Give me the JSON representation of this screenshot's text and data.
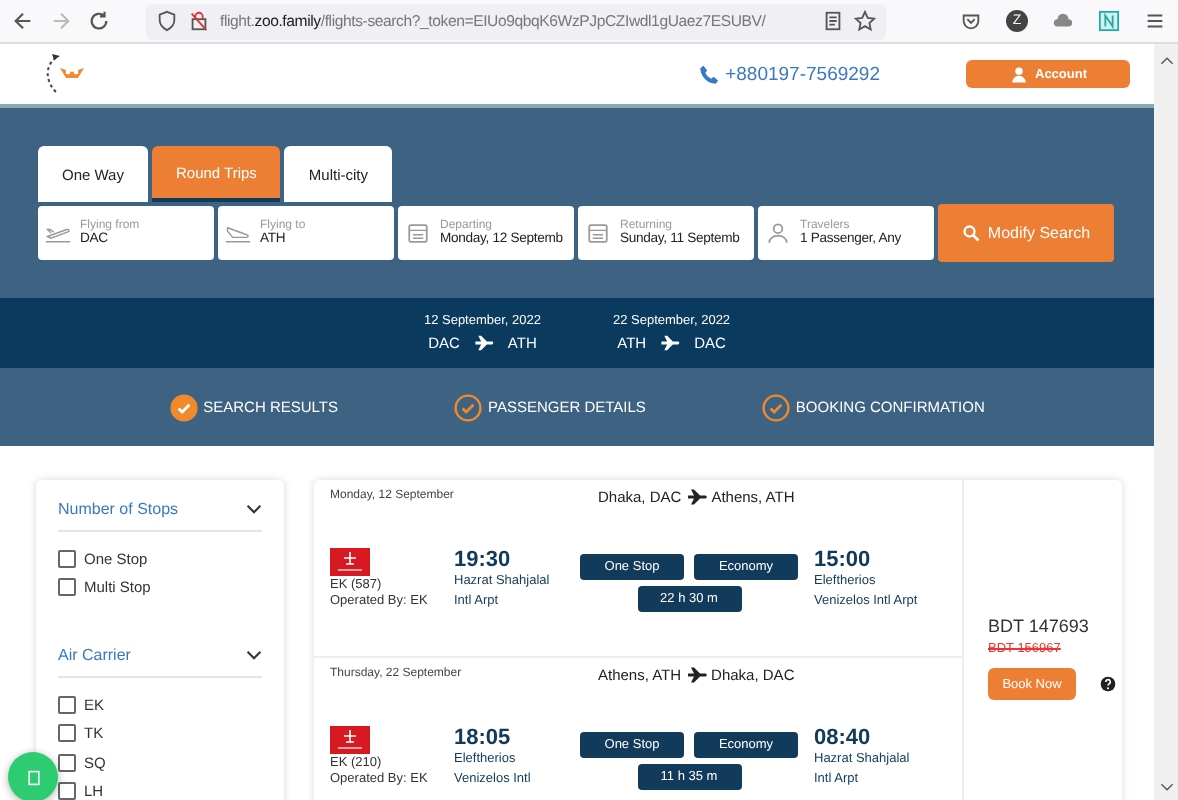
{
  "browser": {
    "url": "flight.**zoo.family**/flights-search?_token=EIUo9qbqK6WzPJpCZIwdl1gUaez7ESUBV/",
    "profile": "Z"
  },
  "header": {
    "phone": "+880197-7569292",
    "account_button": "Account"
  },
  "search": {
    "tabs": [
      {
        "label": "One Way",
        "selected": false
      },
      {
        "label": "Round Trips",
        "selected": true
      },
      {
        "label": "Multi-city",
        "selected": false
      }
    ],
    "fields": [
      {
        "kind": "plane-up",
        "label": "Flying from",
        "value": "DAC"
      },
      {
        "kind": "plane-down",
        "label": "Flying to",
        "value": "ATH"
      },
      {
        "kind": "calendar",
        "label": "Departing",
        "value": "Monday, 12 Septemb"
      },
      {
        "kind": "calendar",
        "label": "Returning",
        "value": "Sunday, 11 Septemb"
      },
      {
        "kind": "person",
        "label": "Travelers",
        "value": "1 Passenger, Any"
      }
    ],
    "button": "Modify Search"
  },
  "legs": [
    {
      "date": "12 September, 2022",
      "from": "DAC",
      "to": "ATH"
    },
    {
      "date": "22 September, 2022",
      "from": "ATH",
      "to": "DAC"
    }
  ],
  "steps": [
    {
      "label": "SEARCH RESULTS",
      "completed": true
    },
    {
      "label": "PASSENGER DETAILS",
      "completed": false
    },
    {
      "label": "BOOKING CONFIRMATION",
      "completed": false
    }
  ],
  "filters": [
    {
      "title": "Number of Stops",
      "options": [
        {
          "label": "One Stop",
          "checked": false
        },
        {
          "label": "Multi Stop",
          "checked": false
        }
      ]
    },
    {
      "title": "Air Carrier",
      "options": [
        {
          "label": "EK",
          "checked": false
        },
        {
          "label": "TK",
          "checked": false
        },
        {
          "label": "SQ",
          "checked": false
        },
        {
          "label": "LH",
          "checked": false
        }
      ]
    }
  ],
  "result": {
    "flights": [
      {
        "date": "Monday, 12 September",
        "route_from": "Dhaka, DAC",
        "route_to": "Athens, ATH",
        "flight_no": "EK (587)",
        "operated_by": "Operated By: EK",
        "dep_time": "19:30",
        "dep_airport": "Hazrat Shahjalal Intl Arpt",
        "stops": "One Stop",
        "cabin": "Economy",
        "duration": "22 h 30 m",
        "arr_time": "15:00",
        "arr_airport": "Eleftherios Venizelos Intl Arpt"
      },
      {
        "date": "Thursday, 22 September",
        "route_from": "Athens, ATH",
        "route_to": "Dhaka, DAC",
        "flight_no": "EK (210)",
        "operated_by": "Operated By: EK",
        "dep_time": "18:05",
        "dep_airport": "Eleftherios Venizelos Intl",
        "stops": "One Stop",
        "cabin": "Economy",
        "duration": "11 h 35 m",
        "arr_time": "08:40",
        "arr_airport": "Hazrat Shahjalal Intl Arpt"
      }
    ],
    "price": "BDT 147693",
    "old_price": "BDT 156967",
    "book_button": "Book Now"
  }
}
